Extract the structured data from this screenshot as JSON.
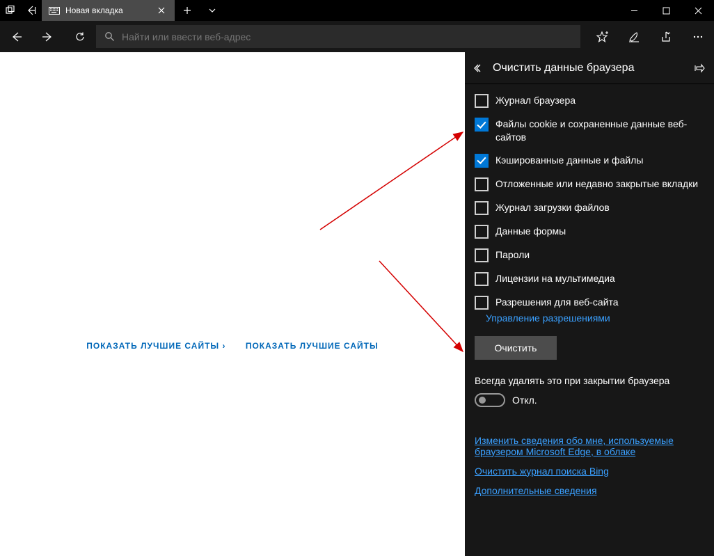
{
  "tab": {
    "title": "Новая вкладка"
  },
  "addressbar": {
    "placeholder": "Найти или ввести веб-адрес"
  },
  "content": {
    "link1": "ПОКАЗАТЬ ЛУЧШИЕ САЙТЫ ›",
    "link2": "ПОКАЗАТЬ ЛУЧШИЕ САЙТЫ "
  },
  "panel": {
    "title": "Очистить данные браузера",
    "items": [
      {
        "label": "Журнал браузера",
        "checked": false
      },
      {
        "label": "Файлы cookie и сохраненные данные веб-сайтов",
        "checked": true
      },
      {
        "label": "Кэшированные данные и файлы",
        "checked": true
      },
      {
        "label": "Отложенные или недавно закрытые вкладки",
        "checked": false
      },
      {
        "label": "Журнал загрузки файлов",
        "checked": false
      },
      {
        "label": "Данные формы",
        "checked": false
      },
      {
        "label": "Пароли",
        "checked": false
      },
      {
        "label": "Лицензии на мультимедиа",
        "checked": false
      },
      {
        "label": "Разрешения для веб-сайта",
        "checked": false
      }
    ],
    "manage_link": "Управление разрешениями",
    "clear_btn": "Очистить",
    "always_label": "Всегда удалять это при закрытии браузера",
    "toggle_state": "Откл.",
    "bottom_links": [
      "Изменить сведения обо мне, используемые браузером Microsoft Edge, в облаке",
      "Очистить журнал поиска Bing",
      "Дополнительные сведения"
    ]
  }
}
